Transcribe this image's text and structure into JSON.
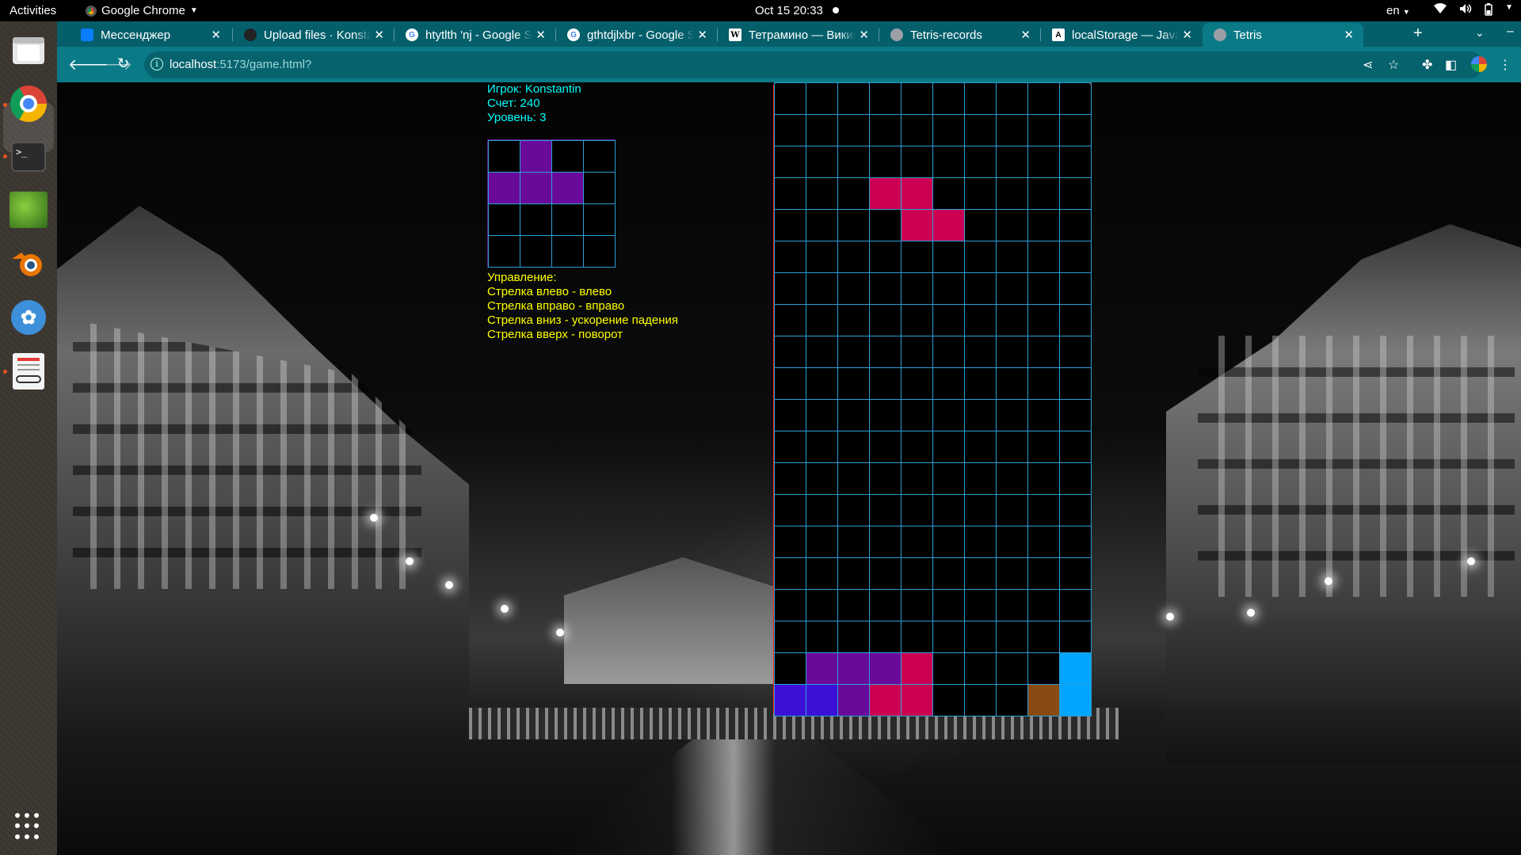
{
  "topbar": {
    "activities": "Activities",
    "app_name": "Google Chrome",
    "clock": "Oct 15  20:33",
    "language": "en"
  },
  "dock": {
    "items": [
      {
        "name": "files",
        "running": false
      },
      {
        "name": "google-chrome",
        "running": true,
        "active": true
      },
      {
        "name": "terminal",
        "running": true
      },
      {
        "name": "image-viewer",
        "running": false
      },
      {
        "name": "blender",
        "running": false
      },
      {
        "name": "kdenlive",
        "running": false
      },
      {
        "name": "document-viewer",
        "running": true
      }
    ]
  },
  "tabs": [
    {
      "title": "Мессенджер",
      "icon": "chat-icon",
      "color": "#0a7cff"
    },
    {
      "title": "Upload files · Konstant",
      "icon": "github-icon",
      "color": "#222222"
    },
    {
      "title": "htytlth 'nj - Google Search",
      "icon": "google-icon",
      "color": "#ffffff"
    },
    {
      "title": "gthtdjlxbr - Google Search",
      "icon": "google-icon",
      "color": "#ffffff"
    },
    {
      "title": "Тетрамино — Википедия",
      "icon": "wikipedia-icon",
      "color": "#ffffff"
    },
    {
      "title": "Tetris-records",
      "icon": "globe-icon",
      "color": "#9aa0a6"
    },
    {
      "title": "localStorage — JavaScript",
      "icon": "javascript-icon",
      "color": "#000000"
    },
    {
      "title": "Tetris",
      "icon": "globe-icon",
      "color": "#9aa0a6",
      "active": true
    }
  ],
  "address_bar": {
    "host": "localhost",
    "path": ":5173/game.html?"
  },
  "game": {
    "player_line": "Игрок: Konstantin",
    "score_line": "Счет: 240",
    "level_line": "Уровень: 3",
    "controls_title": "Управление:",
    "controls": [
      "Стрелка влево - влево",
      "Стрелка вправо - вправо",
      "Стрелка вниз - ускорение падения",
      "Стрелка вверх - поворот"
    ],
    "colors": {
      "text_info": "#00ffff",
      "text_controls": "#ffff00",
      "grid_line": "#2c9fd6",
      "board_border": "#ff2020"
    },
    "board": {
      "columns": 10,
      "rows": 20,
      "filled": [
        {
          "col": 3,
          "row": 3,
          "color": "#cc0052"
        },
        {
          "col": 4,
          "row": 3,
          "color": "#cc0052"
        },
        {
          "col": 4,
          "row": 4,
          "color": "#cc0052"
        },
        {
          "col": 5,
          "row": 4,
          "color": "#cc0052"
        },
        {
          "col": 1,
          "row": 18,
          "color": "#6a0a9a"
        },
        {
          "col": 2,
          "row": 18,
          "color": "#6a0a9a"
        },
        {
          "col": 3,
          "row": 18,
          "color": "#6a0a9a"
        },
        {
          "col": 4,
          "row": 18,
          "color": "#cc0052"
        },
        {
          "col": 9,
          "row": 18,
          "color": "#00a6ff"
        },
        {
          "col": 0,
          "row": 19,
          "color": "#3d10d8"
        },
        {
          "col": 1,
          "row": 19,
          "color": "#3d10d8"
        },
        {
          "col": 2,
          "row": 19,
          "color": "#6a0a9a"
        },
        {
          "col": 3,
          "row": 19,
          "color": "#cc0052"
        },
        {
          "col": 4,
          "row": 19,
          "color": "#cc0052"
        },
        {
          "col": 8,
          "row": 19,
          "color": "#8a4a12"
        },
        {
          "col": 9,
          "row": 19,
          "color": "#00a6ff"
        }
      ]
    },
    "next_piece": {
      "columns": 4,
      "rows": 4,
      "filled": [
        {
          "col": 1,
          "row": 0,
          "color": "#6a0a9a"
        },
        {
          "col": 0,
          "row": 1,
          "color": "#6a0a9a"
        },
        {
          "col": 1,
          "row": 1,
          "color": "#6a0a9a"
        },
        {
          "col": 2,
          "row": 1,
          "color": "#6a0a9a"
        }
      ]
    }
  }
}
